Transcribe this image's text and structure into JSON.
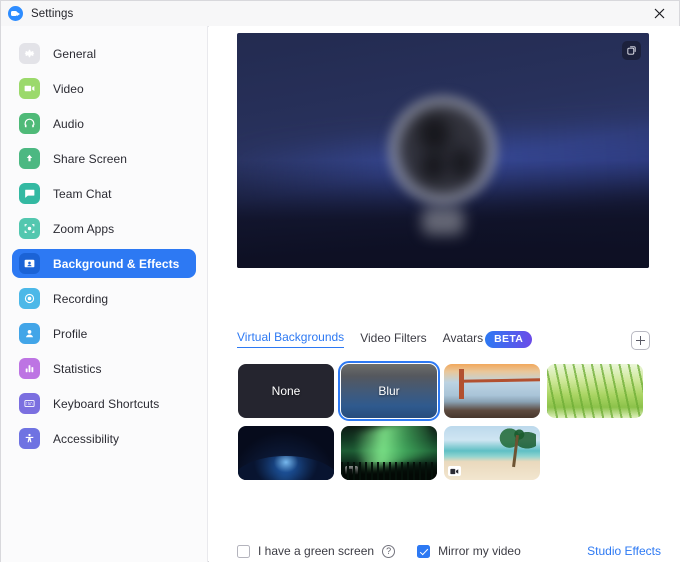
{
  "window": {
    "title": "Settings",
    "logo_icon": "zoom-logo-icon",
    "close_icon": "close-icon"
  },
  "sidebar": {
    "items": [
      {
        "label": "General",
        "icon": "gear-icon",
        "color": "#c9c9d0",
        "active": false
      },
      {
        "label": "Video",
        "icon": "video-camera-icon",
        "color": "#8ed05a",
        "active": false
      },
      {
        "label": "Audio",
        "icon": "headphones-icon",
        "color": "#3fae6a",
        "active": false
      },
      {
        "label": "Share Screen",
        "icon": "share-screen-icon",
        "color": "#3fb07a",
        "active": false
      },
      {
        "label": "Team Chat",
        "icon": "chat-bubble-icon",
        "color": "#2fb39b",
        "active": false
      },
      {
        "label": "Zoom Apps",
        "icon": "zoom-apps-icon",
        "color": "#49c0a8",
        "active": false
      },
      {
        "label": "Background & Effects",
        "icon": "person-card-icon",
        "color": "#2D79F3",
        "active": true
      },
      {
        "label": "Recording",
        "icon": "record-circle-icon",
        "color": "#4cb8e8",
        "active": false
      },
      {
        "label": "Profile",
        "icon": "profile-person-icon",
        "color": "#42a5e8",
        "active": false
      },
      {
        "label": "Statistics",
        "icon": "bar-chart-icon",
        "color": "#b870e0",
        "active": false
      },
      {
        "label": "Keyboard Shortcuts",
        "icon": "keyboard-icon",
        "color": "#7b6fe0",
        "active": false
      },
      {
        "label": "Accessibility",
        "icon": "accessibility-icon",
        "color": "#6f73e2",
        "active": false
      }
    ]
  },
  "main": {
    "preview": {
      "snapshot_icon": "snapshot-camera-icon"
    },
    "tabs": [
      {
        "label": "Virtual Backgrounds",
        "active": true
      },
      {
        "label": "Video Filters",
        "active": false
      },
      {
        "label": "Avatars",
        "active": false
      }
    ],
    "beta_badge": "BETA",
    "add_button_icon": "plus-icon",
    "backgrounds": [
      [
        {
          "name": "None",
          "label": "None",
          "style": "t-none",
          "selected": false,
          "video": false
        },
        {
          "name": "Blur",
          "label": "Blur",
          "style": "t-blur",
          "selected": true,
          "video": false
        },
        {
          "name": "Golden Gate Bridge",
          "label": "",
          "style": "t-bridge",
          "selected": false,
          "video": false
        },
        {
          "name": "Grass",
          "label": "",
          "style": "t-grass",
          "selected": false,
          "video": false
        }
      ],
      [
        {
          "name": "Earth from Space",
          "label": "",
          "style": "t-earth",
          "selected": false,
          "video": false
        },
        {
          "name": "Aurora Forest",
          "label": "",
          "style": "t-aurora",
          "selected": false,
          "video": true
        },
        {
          "name": "Beach Palm",
          "label": "",
          "style": "t-beach",
          "selected": false,
          "video": true
        }
      ]
    ],
    "footer": {
      "green_screen_label": "I have a green screen",
      "green_screen_checked": false,
      "help_icon": "help-question-icon",
      "help_glyph": "?",
      "mirror_label": "Mirror my video",
      "mirror_checked": true,
      "studio_effects_label": "Studio Effects"
    }
  },
  "colors": {
    "accent": "#2D79F3",
    "beta_gradient_start": "#2D79F3",
    "beta_gradient_end": "#6B4BE8"
  }
}
